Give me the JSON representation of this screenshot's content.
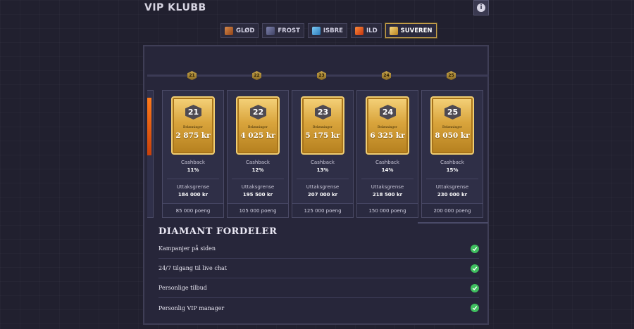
{
  "header": {
    "title": "VIP KLUBB",
    "info_icon": "info-icon"
  },
  "tabs": [
    {
      "label": "GLØD",
      "color": "#b8612b",
      "active": false
    },
    {
      "label": "FROST",
      "color": "#5a5d84",
      "active": false
    },
    {
      "label": "ISBRE",
      "color": "#3f9fd8",
      "active": false
    },
    {
      "label": "ILD",
      "color": "#e0541e",
      "active": false
    },
    {
      "label": "SUVEREN",
      "color": "#d9a73a",
      "active": true
    }
  ],
  "track_nodes": [
    "21",
    "22",
    "23",
    "24",
    "25"
  ],
  "cards": [
    {
      "level": "21",
      "reward_label": "Belønninger",
      "reward_value": "2 875 kr",
      "cashback_label": "Cashback",
      "cashback_value": "11%",
      "limit_label": "Uttaksgrense",
      "limit_value": "184 000 kr",
      "points": "85 000 poeng"
    },
    {
      "level": "22",
      "reward_label": "Belønninger",
      "reward_value": "4 025 kr",
      "cashback_label": "Cashback",
      "cashback_value": "12%",
      "limit_label": "Uttaksgrense",
      "limit_value": "195 500 kr",
      "points": "105 000 poeng"
    },
    {
      "level": "23",
      "reward_label": "Belønninger",
      "reward_value": "5 175 kr",
      "cashback_label": "Cashback",
      "cashback_value": "13%",
      "limit_label": "Uttaksgrense",
      "limit_value": "207 000 kr",
      "points": "125 000 poeng"
    },
    {
      "level": "24",
      "reward_label": "Belønninger",
      "reward_value": "6 325 kr",
      "cashback_label": "Cashback",
      "cashback_value": "14%",
      "limit_label": "Uttaksgrense",
      "limit_value": "218 500 kr",
      "points": "150 000 poeng"
    },
    {
      "level": "25",
      "reward_label": "Belønninger",
      "reward_value": "8 050 kr",
      "cashback_label": "Cashback",
      "cashback_value": "15%",
      "limit_label": "Uttaksgrense",
      "limit_value": "230 000 kr",
      "points": "200 000 poeng"
    }
  ],
  "benefits": {
    "title": "DIAMANT FORDELER",
    "items": [
      {
        "label": "Kampanjer på siden",
        "included": true
      },
      {
        "label": "24/7 tilgang til live chat",
        "included": true
      },
      {
        "label": "Personlige tilbud",
        "included": true
      },
      {
        "label": "Personlig VIP manager",
        "included": true
      }
    ]
  },
  "colors": {
    "accent_gold": "#d9a73a",
    "check_green": "#3fbf5f",
    "background": "#21202f"
  }
}
